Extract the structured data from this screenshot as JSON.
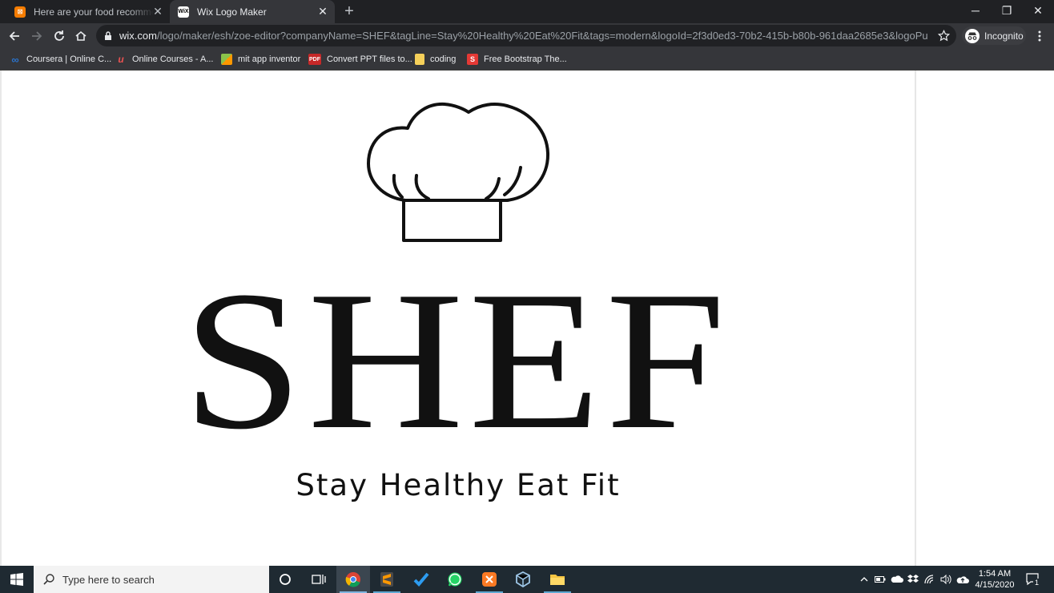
{
  "browser": {
    "tabs": [
      {
        "title": "Here are your food recommenda",
        "active": false
      },
      {
        "title": "Wix Logo Maker",
        "active": true
      }
    ],
    "window_controls": {
      "minimize": "─",
      "restore": "❐",
      "close": "✕"
    },
    "url_host": "wix.com",
    "url_rest": "/logo/maker/esh/zoe-editor?companyName=SHEF&tagLine=Stay%20Healthy%20Eat%20Fit&tags=modern&logoId=2f3d0ed3-70b2-415b-b80b-961daa2685e3&logoPurpose=webs...",
    "profile_label": "Incognito",
    "bookmarks": [
      {
        "label": "Coursera | Online C...",
        "icon": "coursera-icon",
        "color": "#2a73cc"
      },
      {
        "label": "Online Courses - A...",
        "icon": "udemy-icon",
        "color": "#ec5252"
      },
      {
        "label": "mit app inventor",
        "icon": "app-inventor-icon",
        "color": "#8bc34a"
      },
      {
        "label": "Convert PPT files to...",
        "icon": "pdf-icon",
        "color": "#c62828",
        "badge": "PDF"
      },
      {
        "label": "coding",
        "icon": "folder-icon",
        "color": "#f5d05a"
      },
      {
        "label": "Free Bootstrap The...",
        "icon": "bootstrap-icon",
        "color": "#e53935",
        "badge": "S"
      }
    ]
  },
  "logo": {
    "company_name": "SHEF",
    "tagline": "Stay Healthy Eat Fit",
    "icon": "chef-hat-icon"
  },
  "taskbar": {
    "search_placeholder": "Type here to search",
    "apps": [
      "cortana-icon",
      "task-view-icon",
      "chrome-icon",
      "sublime-icon",
      "vscode-icon",
      "whatsapp-icon",
      "xampp-icon",
      "virtualbox-icon",
      "file-explorer-icon"
    ],
    "time": "1:54 AM",
    "date": "4/15/2020",
    "notification_count": "1"
  },
  "colors": {
    "chrome_dark": "#202124",
    "chrome_toolbar": "#35363a",
    "taskbar": "#1f2a32",
    "logo_ink": "#111111"
  }
}
